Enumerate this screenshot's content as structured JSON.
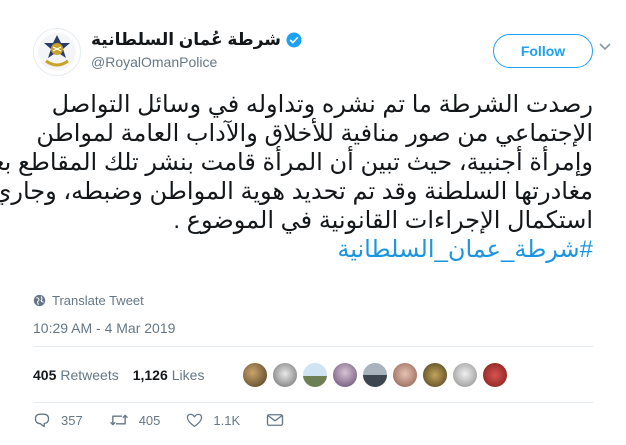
{
  "user": {
    "name": "شرطة عُمان السلطانية",
    "handle": "@RoyalOmanPolice"
  },
  "follow_label": "Follow",
  "tweet_lines": [
    "رصدت الشرطة ما تم نشره وتداوله في وسائل التواصل",
    "الإجتماعي من صور منافية للأخلاق والآداب العامة لمواطن",
    "وإمرأة أجنبية، حيث تبين أن المرأة قامت بنشر تلك المقاطع بعد",
    "مغادرتها السلطنة وقد تم تحديد هوية المواطن وضبطه، وجاري",
    "استكمال الإجراءات القانونية في الموضوع ."
  ],
  "hashtag": "#شرطة_عمان_السلطانية",
  "translate_label": "Translate Tweet",
  "timestamp": "10:29 AM - 4 Mar 2019",
  "stats": {
    "retweets_count": "405",
    "retweets_label": "Retweets",
    "likes_count": "1,126",
    "likes_label": "Likes"
  },
  "actions": {
    "replies": "357",
    "retweets": "405",
    "likes": "1.1K"
  },
  "colors": {
    "accent": "#1da1f2",
    "hashtag": "#1b95e0",
    "muted": "#657786"
  },
  "icons": [
    "verified-badge-icon",
    "globe-icon",
    "caret-down-icon",
    "reply-icon",
    "retweet-icon",
    "like-icon",
    "mail-icon"
  ]
}
